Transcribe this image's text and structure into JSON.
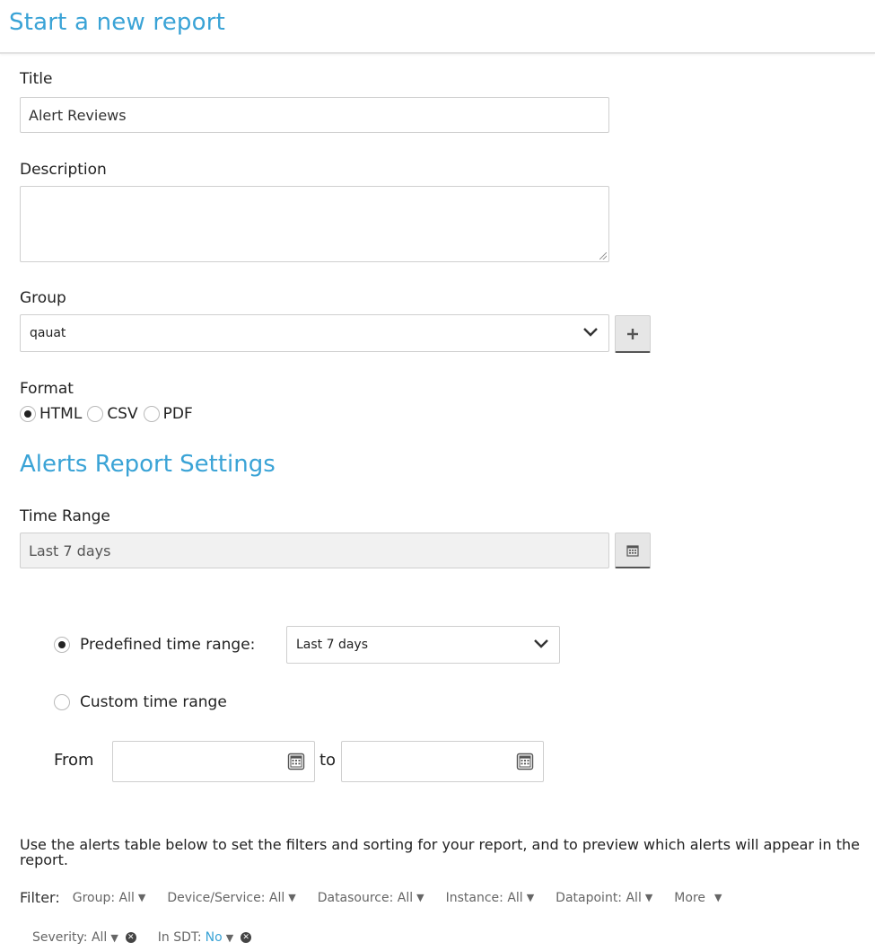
{
  "page": {
    "title": "Start a new report"
  },
  "form": {
    "title_label": "Title",
    "title_value": "Alert Reviews",
    "description_label": "Description",
    "description_value": "",
    "group_label": "Group",
    "group_value": "qauat",
    "add_group_icon": "plus-icon",
    "format_label": "Format",
    "format_options": [
      "HTML",
      "CSV",
      "PDF"
    ],
    "format_selected": "HTML"
  },
  "settings": {
    "title": "Alerts Report Settings",
    "time_range_label": "Time Range",
    "time_range_value": "Last 7 days",
    "calendar_icon": "calendar-icon",
    "predefined_label": "Predefined time range:",
    "predefined_value": "Last 7 days",
    "custom_label": "Custom time range",
    "selected_mode": "predefined",
    "from_label": "From",
    "to_label": "to",
    "from_value": "",
    "to_value": ""
  },
  "info": {
    "text": "Use the alerts table below to set the filters and sorting for your report, and to preview which alerts will appear in the report."
  },
  "filters": {
    "label": "Filter:",
    "row1": [
      "Group: All",
      "Device/Service: All",
      "Datasource: All",
      "Instance: All",
      "Datapoint: All",
      "More"
    ],
    "severity": "Severity: All",
    "sdt_label": "In SDT:",
    "sdt_value": "No"
  },
  "colors": {
    "accent": "#3aa3d6",
    "border": "#cfcfcf",
    "readonly_bg": "#f1f1f1"
  }
}
